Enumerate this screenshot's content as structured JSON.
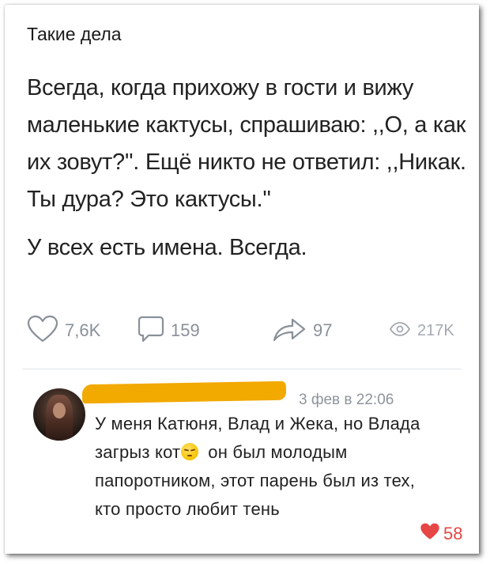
{
  "post": {
    "group_name": "Такие дела",
    "paragraph_1": "Всегда, когда прихожу в гости и вижу маленькие кактусы, спрашиваю: ,,О, а как их зовут?''. Ещё никто не ответил: ,,Никак. Ты дура? Это кактусы.''",
    "paragraph_2": "У всех есть имена. Всегда.",
    "likes": "7,6K",
    "comments": "159",
    "shares": "97",
    "views": "217K"
  },
  "comment": {
    "date": "3 фев в 22:06",
    "text_before_emoji": "У меня Катюня, Влад и Жека, но Влада загрыз кот",
    "text_after_emoji": "он был молодым папоротником, этот парень был из тех, кто просто любит тень",
    "likes": "58"
  },
  "colors": {
    "redaction": "#f2a900",
    "like_red": "#e64646",
    "icon_gray": "#8a9099"
  },
  "icons": [
    "heart-outline-icon",
    "comment-bubble-icon",
    "share-arrow-icon",
    "eye-icon",
    "heart-filled-icon",
    "pensive-emoji-icon"
  ]
}
